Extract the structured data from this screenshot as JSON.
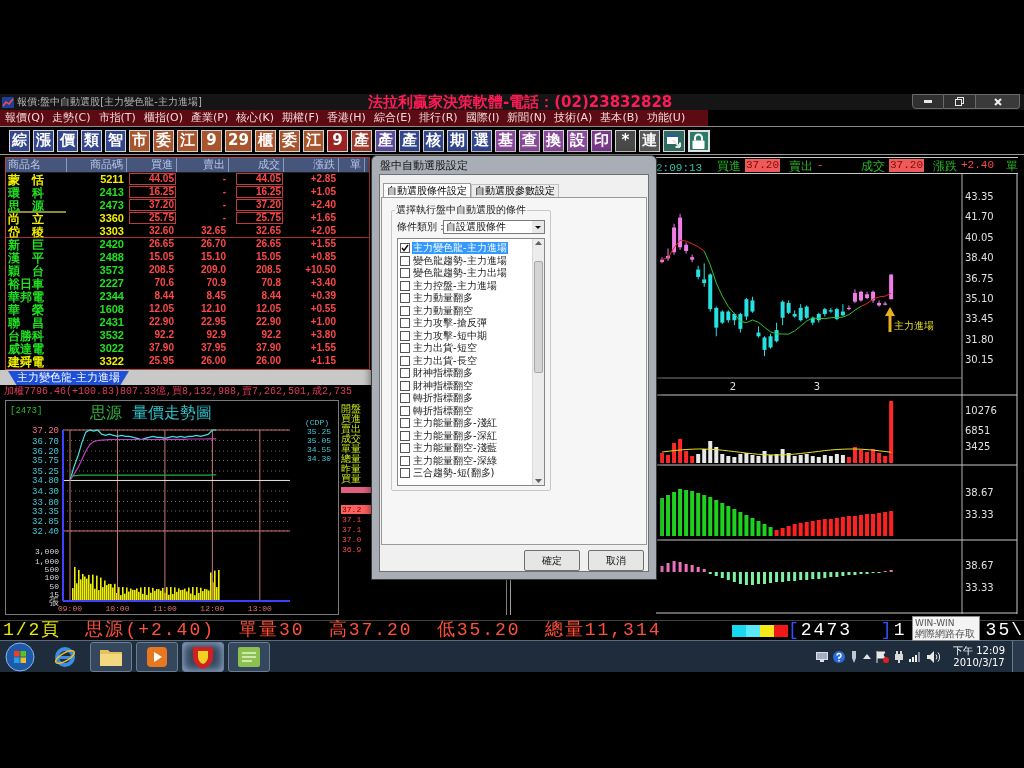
{
  "window": {
    "title": "報價:盤中自動選股[主力變色龍-主力進場]",
    "banner": "法拉利贏家決策軟體-電話：(02)23832828"
  },
  "menu": [
    "報價(Q)",
    "走勢(C)",
    "市指(T)",
    "櫃指(O)",
    "產業(P)",
    "核心(K)",
    "期權(F)",
    "香港(H)",
    "綜合(E)",
    "排行(R)",
    "國際(I)",
    "新聞(N)",
    "技術(A)",
    "基本(B)",
    "功能(U)"
  ],
  "toolbar": [
    {
      "kind": "text",
      "label": "綜",
      "color": "#34468c"
    },
    {
      "kind": "text",
      "label": "漲",
      "color": "#34468c"
    },
    {
      "kind": "text",
      "label": "價",
      "color": "#34468c"
    },
    {
      "kind": "text",
      "label": "類",
      "color": "#34468c"
    },
    {
      "kind": "text",
      "label": "智",
      "color": "#34468c"
    },
    {
      "kind": "text",
      "label": "市",
      "color": "#a8542c"
    },
    {
      "kind": "text",
      "label": "委",
      "color": "#a8542c"
    },
    {
      "kind": "text",
      "label": "江",
      "color": "#a8542c"
    },
    {
      "kind": "text",
      "label": "9",
      "color": "#a8542c"
    },
    {
      "kind": "text",
      "label": "29",
      "color": "#a8542c"
    },
    {
      "kind": "text",
      "label": "櫃",
      "color": "#a8542c"
    },
    {
      "kind": "text",
      "label": "委",
      "color": "#a8542c"
    },
    {
      "kind": "text",
      "label": "江",
      "color": "#a8542c"
    },
    {
      "kind": "text",
      "label": "9",
      "color": "#9a2222"
    },
    {
      "kind": "text",
      "label": "產",
      "color": "#9a3a2a"
    },
    {
      "kind": "text",
      "label": "產",
      "color": "#5c4c9c"
    },
    {
      "kind": "text",
      "label": "產",
      "color": "#34468c"
    },
    {
      "kind": "text",
      "label": "核",
      "color": "#34468c"
    },
    {
      "kind": "text",
      "label": "期",
      "color": "#34468c"
    },
    {
      "kind": "text",
      "label": "選",
      "color": "#34468c"
    },
    {
      "kind": "text",
      "label": "基",
      "color": "#8a4a9a"
    },
    {
      "kind": "text",
      "label": "查",
      "color": "#8a4a9a"
    },
    {
      "kind": "text",
      "label": "換",
      "color": "#8a4a9a"
    },
    {
      "kind": "text",
      "label": "設",
      "color": "#8a4a9a"
    },
    {
      "kind": "text",
      "label": "印",
      "color": "#7a3a8a"
    },
    {
      "kind": "text",
      "label": "*",
      "color": "#4a4a4a"
    },
    {
      "kind": "text",
      "label": "連",
      "color": "#5a5a5a"
    },
    {
      "kind": "window",
      "color": "#2e6a5e"
    },
    {
      "kind": "lock",
      "color": "#2e7a6a"
    }
  ],
  "quote_table": {
    "columns": [
      "商品名",
      "商品碼",
      "買進",
      "賣出",
      "成交",
      "漲跌",
      "單"
    ],
    "rows": [
      {
        "name": "蒙　恬",
        "code": "5211",
        "bid": "44.05",
        "ask": "-",
        "last": "44.05",
        "change": "+2.85",
        "color": "#f0f000",
        "limit_up": true,
        "selected": false,
        "divider_below": false
      },
      {
        "name": "環　科",
        "code": "2413",
        "bid": "16.25",
        "ask": "-",
        "last": "16.25",
        "change": "+1.05",
        "color": "#20e020",
        "limit_up": true,
        "selected": false,
        "divider_below": false
      },
      {
        "name": "思　源",
        "code": "2473",
        "bid": "37.20",
        "ask": "-",
        "last": "37.20",
        "change": "+2.40",
        "color": "#20e020",
        "limit_up": true,
        "selected": true,
        "divider_below": false
      },
      {
        "name": "尚　立",
        "code": "3360",
        "bid": "25.75",
        "ask": "-",
        "last": "25.75",
        "change": "+1.65",
        "color": "#f0f000",
        "limit_up": true,
        "selected": false,
        "divider_below": false
      },
      {
        "name": "岱　稜",
        "code": "3303",
        "bid": "32.60",
        "ask": "32.65",
        "last": "32.65",
        "change": "+2.05",
        "color": "#f0f000",
        "limit_up": false,
        "selected": false,
        "divider_below": true
      },
      {
        "name": "新　巨",
        "code": "2420",
        "bid": "26.65",
        "ask": "26.70",
        "last": "26.65",
        "change": "+1.55",
        "color": "#20e020",
        "limit_up": false,
        "selected": false,
        "divider_below": false
      },
      {
        "name": "漢　平",
        "code": "2488",
        "bid": "15.05",
        "ask": "15.10",
        "last": "15.05",
        "change": "+0.85",
        "color": "#20e020",
        "limit_up": false,
        "selected": false,
        "divider_below": false
      },
      {
        "name": "穎　台",
        "code": "3573",
        "bid": "208.5",
        "ask": "209.0",
        "last": "208.5",
        "change": "+10.50",
        "color": "#20e020",
        "limit_up": false,
        "selected": false,
        "divider_below": false
      },
      {
        "name": "裕日車",
        "code": "2227",
        "bid": "70.6",
        "ask": "70.9",
        "last": "70.8",
        "change": "+3.40",
        "color": "#20e020",
        "limit_up": false,
        "selected": false,
        "divider_below": false
      },
      {
        "name": "華邦電",
        "code": "2344",
        "bid": "8.44",
        "ask": "8.45",
        "last": "8.44",
        "change": "+0.39",
        "color": "#20e020",
        "limit_up": false,
        "selected": false,
        "divider_below": false
      },
      {
        "name": "華　榮",
        "code": "1608",
        "bid": "12.05",
        "ask": "12.10",
        "last": "12.05",
        "change": "+0.55",
        "color": "#20e020",
        "limit_up": false,
        "selected": false,
        "divider_below": false
      },
      {
        "name": "聯　昌",
        "code": "2431",
        "bid": "22.90",
        "ask": "22.95",
        "last": "22.90",
        "change": "+1.00",
        "color": "#20e020",
        "limit_up": false,
        "selected": false,
        "divider_below": false
      },
      {
        "name": "台勝科",
        "code": "3532",
        "bid": "92.2",
        "ask": "92.9",
        "last": "92.2",
        "change": "+3.80",
        "color": "#20e020",
        "limit_up": false,
        "selected": false,
        "divider_below": false
      },
      {
        "name": "威達電",
        "code": "3022",
        "bid": "37.90",
        "ask": "37.95",
        "last": "37.90",
        "change": "+1.55",
        "color": "#20e020",
        "limit_up": false,
        "selected": false,
        "divider_below": false
      },
      {
        "name": "建舜電",
        "code": "3322",
        "bid": "25.95",
        "ask": "26.00",
        "last": "26.00",
        "change": "+1.15",
        "color": "#f0f000",
        "limit_up": false,
        "selected": false,
        "divider_below": false
      }
    ]
  },
  "sheet_tabs": [
    {
      "label": "主力變色龍-主力進場",
      "selected": true
    }
  ],
  "ticker": "加權7796.46(+100.83)807.33億,買8,132,988,賣7,262,501,成2,735",
  "intraday_chart": {
    "code": "[2473]",
    "name": "思源",
    "title": "量價走勢圖",
    "volume_labels": [
      "3,000",
      "1,000",
      "500",
      "100",
      "50",
      "15",
      "張"
    ],
    "cdp_label": "(CDP)",
    "cdp_values": [
      "35.25",
      "35.05",
      "34.55",
      "34.30"
    ],
    "chart_data": {
      "type": "line",
      "grid": true,
      "categories": [
        "09:00",
        null,
        null,
        null,
        null,
        null,
        null,
        null,
        null,
        null,
        null,
        null,
        "10:00",
        null,
        null,
        null,
        null,
        null,
        null,
        null,
        null,
        null,
        null,
        null,
        "11:00",
        null,
        null,
        null,
        null,
        null,
        null,
        null,
        null,
        null,
        null,
        null,
        "12:00",
        null,
        null,
        null,
        null,
        null,
        null,
        null,
        null,
        null,
        null,
        null,
        "13:00",
        null,
        null,
        null
      ],
      "ylim": [
        29.07,
        37.2
      ],
      "yticks": [
        {
          "value": 37.2,
          "label": "37.20"
        },
        {
          "value": 36.7,
          "label": "36.70"
        },
        {
          "value": 36.2,
          "label": "36.20"
        },
        {
          "value": 35.75,
          "label": "35.75"
        },
        {
          "value": 35.25,
          "label": "35.25"
        },
        {
          "value": 34.8,
          "label": "34.80"
        },
        {
          "value": 34.3,
          "label": "34.30"
        },
        {
          "value": 33.8,
          "label": "33.80"
        },
        {
          "value": 33.35,
          "label": "33.35"
        },
        {
          "value": 32.85,
          "label": "32.85"
        },
        {
          "value": 32.4,
          "label": "32.40"
        }
      ],
      "ref_lines": [
        {
          "axis": "y",
          "value": 37.2,
          "color": "#d07070"
        },
        {
          "axis": "y",
          "value": 34.8,
          "color": "#e0e0e0"
        },
        {
          "axis": "y",
          "value": 32.4,
          "color": "#d07070"
        }
      ],
      "series": [
        {
          "color": "#40e0e0",
          "values": [
            34.8,
            35.45,
            35.95,
            36.6,
            37.1,
            37.2,
            37.15,
            37.2,
            37.0,
            36.95,
            37.0,
            36.95,
            36.9,
            36.95,
            36.9,
            36.9,
            36.85,
            36.8,
            36.75,
            36.8,
            36.85,
            36.9,
            36.85,
            36.85,
            36.8,
            36.85,
            36.9,
            36.85,
            36.9,
            36.85,
            36.9,
            36.9,
            36.95,
            36.9,
            36.95,
            37.0,
            37.2,
            37.2,
            null,
            null,
            null,
            null,
            null,
            null,
            null,
            null,
            null,
            null,
            null,
            null,
            null,
            null
          ]
        },
        {
          "color": "#c040c0",
          "values": [
            34.8,
            35.1,
            35.4,
            35.8,
            36.2,
            36.5,
            36.65,
            36.7,
            36.72,
            36.73,
            36.74,
            36.75,
            36.75,
            36.75,
            36.75,
            36.75,
            36.75,
            36.75,
            36.75,
            36.75,
            36.75,
            36.75,
            36.76,
            36.76,
            36.76,
            36.76,
            36.76,
            36.76,
            36.76,
            36.76,
            36.77,
            36.77,
            36.77,
            36.77,
            36.77,
            36.78,
            36.78,
            36.78,
            null,
            null,
            null,
            null,
            null,
            null,
            null,
            null,
            null,
            null,
            null,
            null,
            null,
            null
          ]
        },
        {
          "color": "#20b040",
          "values": [
            35.0,
            35.02,
            35.04,
            35.05,
            35.05,
            35.06,
            35.05,
            35.05,
            35.06,
            35.05,
            35.05,
            35.05,
            35.06,
            35.05,
            35.05,
            35.05,
            35.05,
            35.06,
            35.05,
            35.05,
            35.05,
            35.05,
            35.06,
            35.05,
            35.05,
            35.05,
            35.05,
            35.05,
            35.06,
            35.05,
            35.05,
            35.05,
            35.05,
            35.06,
            35.05,
            35.05,
            35.07,
            35.07,
            null,
            null,
            null,
            null,
            null,
            null,
            null,
            null,
            null,
            null,
            null,
            null,
            null,
            null
          ]
        }
      ]
    }
  },
  "side_labels": [
    "開盤",
    "買進",
    "賣出",
    "成交",
    "單量",
    "總量",
    "昨量",
    "買量"
  ],
  "order_prices": [
    {
      "price": "37.2",
      "selected": true
    },
    {
      "price": "37.1",
      "selected": false
    },
    {
      "price": "37.1",
      "selected": false
    },
    {
      "price": "37.0",
      "selected": false
    },
    {
      "price": "36.9",
      "selected": false
    }
  ],
  "dialog": {
    "title": "盤中自動選股設定",
    "tabs": [
      {
        "label": "自動選股條件設定",
        "selected": true
      },
      {
        "label": "自動選股參數設定",
        "selected": false
      }
    ],
    "group_title": "選擇執行盤中自動選股的條件",
    "category_label": "條件類別：",
    "category_value": "自設選股條件",
    "conditions": [
      {
        "label": "主力變色龍-主力進場",
        "checked": true,
        "selected": true
      },
      {
        "label": "變色龍趨勢-主力進場",
        "checked": false,
        "selected": false
      },
      {
        "label": "變色龍趨勢-主力出場",
        "checked": false,
        "selected": false
      },
      {
        "label": "主力控盤-主力進場",
        "checked": false,
        "selected": false
      },
      {
        "label": "主力動量翻多",
        "checked": false,
        "selected": false
      },
      {
        "label": "主力動量翻空",
        "checked": false,
        "selected": false
      },
      {
        "label": "主力攻擊-搶反彈",
        "checked": false,
        "selected": false
      },
      {
        "label": "主力攻擊-短中期",
        "checked": false,
        "selected": false
      },
      {
        "label": "主力出貨-短空",
        "checked": false,
        "selected": false
      },
      {
        "label": "主力出貨-長空",
        "checked": false,
        "selected": false
      },
      {
        "label": "財神指標翻多",
        "checked": false,
        "selected": false
      },
      {
        "label": "財神指標翻空",
        "checked": false,
        "selected": false
      },
      {
        "label": "轉折指標翻多",
        "checked": false,
        "selected": false
      },
      {
        "label": "轉折指標翻空",
        "checked": false,
        "selected": false
      },
      {
        "label": "主力能量翻多-淺紅",
        "checked": false,
        "selected": false
      },
      {
        "label": "主力能量翻多-深紅",
        "checked": false,
        "selected": false
      },
      {
        "label": "主力能量翻空-淺藍",
        "checked": false,
        "selected": false
      },
      {
        "label": "主力能量翻空-深綠",
        "checked": false,
        "selected": false
      },
      {
        "label": "三合趨勢-短(翻多)",
        "checked": false,
        "selected": false
      }
    ],
    "buttons": [
      "確定",
      "取消"
    ]
  },
  "candle_header": {
    "time": "2:09:13",
    "fields": [
      {
        "label": "買進",
        "value": "37.20",
        "highlight": true
      },
      {
        "label": "賣出",
        "value": "-",
        "highlight": false
      },
      {
        "label": "成交",
        "value": "37.20",
        "highlight": true
      },
      {
        "label": "漲跌",
        "value": "+2.40",
        "highlight": false
      }
    ],
    "cut_label": "單"
  },
  "candle_chart": {
    "y_labels": [
      "43.35",
      "41.70",
      "40.05",
      "38.40",
      "36.75",
      "35.10",
      "33.45",
      "31.80",
      "30.15"
    ],
    "x_labels": [
      "2",
      "3"
    ],
    "annotation": "主力進場"
  },
  "volume_chart": {
    "y_labels": [
      "10276",
      "6851",
      "3425"
    ]
  },
  "indicators": [
    {
      "kind": "histogram",
      "y_labels": [
        "38.67",
        "33.33"
      ]
    },
    {
      "kind": "oscillator",
      "y_labels": [
        "38.67",
        "33.33"
      ]
    }
  ],
  "status_bar": {
    "page": "1/2頁",
    "items": [
      "思源(+2.40)",
      "單量30",
      "高37.20",
      "低35.20",
      "總量11,314"
    ],
    "swatches": [
      {
        "color": "#18d8f0"
      },
      {
        "color": "#58e8f8"
      },
      {
        "color": "#f8e818"
      },
      {
        "color": "#f01818"
      }
    ],
    "code_open": "[",
    "code": "2473",
    "code_close": "]",
    "trailing": [
      "1",
      "35\\"
    ]
  },
  "tooltip": {
    "title": "WIN-WIN",
    "text": "網際網路存取"
  },
  "taskbar": {
    "apps": [
      {
        "kind": "browser",
        "running": false,
        "selected": false
      },
      {
        "kind": "folder",
        "running": true,
        "selected": false
      },
      {
        "kind": "media",
        "running": true,
        "selected": false
      },
      {
        "kind": "app",
        "running": true,
        "selected": true
      },
      {
        "kind": "notes",
        "running": true,
        "selected": false
      }
    ],
    "clock": "下午 12:09",
    "date": "2010/3/17"
  }
}
